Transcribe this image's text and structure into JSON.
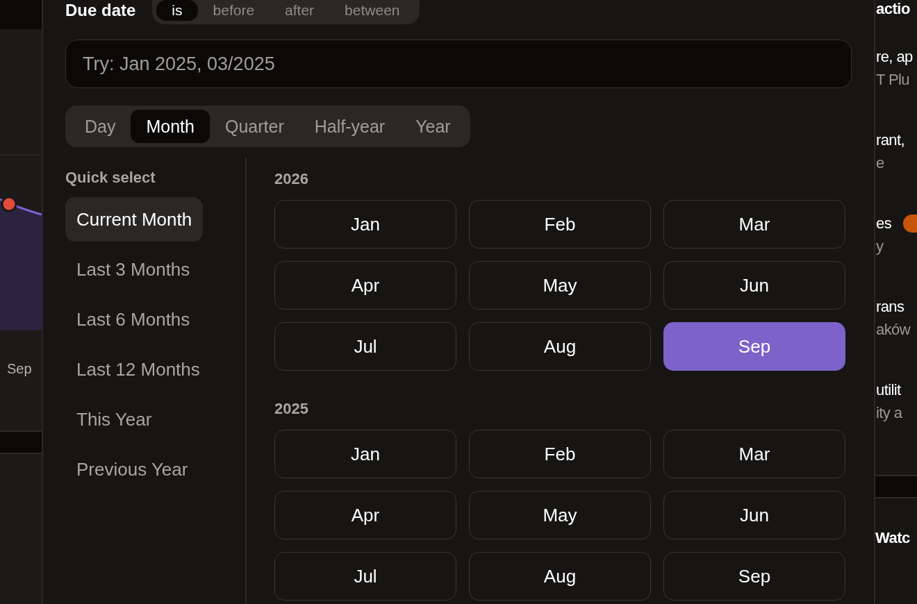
{
  "filter": {
    "label": "Due date",
    "operators": [
      {
        "label": "is",
        "selected": true
      },
      {
        "label": "before",
        "selected": false
      },
      {
        "label": "after",
        "selected": false
      },
      {
        "label": "between",
        "selected": false
      }
    ]
  },
  "search": {
    "placeholder": "Try: Jan 2025, 03/2025"
  },
  "granularity": [
    {
      "label": "Day",
      "selected": false
    },
    {
      "label": "Month",
      "selected": true
    },
    {
      "label": "Quarter",
      "selected": false
    },
    {
      "label": "Half-year",
      "selected": false
    },
    {
      "label": "Year",
      "selected": false
    }
  ],
  "quick_select": {
    "title": "Quick select",
    "items": [
      {
        "label": "Current Month",
        "selected": true
      },
      {
        "label": "Last 3 Months",
        "selected": false
      },
      {
        "label": "Last 6 Months",
        "selected": false
      },
      {
        "label": "Last 12 Months",
        "selected": false
      },
      {
        "label": "This Year",
        "selected": false
      },
      {
        "label": "Previous Year",
        "selected": false
      }
    ]
  },
  "years": [
    {
      "year": "2026",
      "months": [
        {
          "label": "Jan",
          "selected": false
        },
        {
          "label": "Feb",
          "selected": false
        },
        {
          "label": "Mar",
          "selected": false
        },
        {
          "label": "Apr",
          "selected": false
        },
        {
          "label": "May",
          "selected": false
        },
        {
          "label": "Jun",
          "selected": false
        },
        {
          "label": "Jul",
          "selected": false
        },
        {
          "label": "Aug",
          "selected": false
        },
        {
          "label": "Sep",
          "selected": true
        }
      ]
    },
    {
      "year": "2025",
      "months": [
        {
          "label": "Jan",
          "selected": false
        },
        {
          "label": "Feb",
          "selected": false
        },
        {
          "label": "Mar",
          "selected": false
        },
        {
          "label": "Apr",
          "selected": false
        },
        {
          "label": "May",
          "selected": false
        },
        {
          "label": "Jun",
          "selected": false
        },
        {
          "label": "Jul",
          "selected": false
        },
        {
          "label": "Aug",
          "selected": false
        },
        {
          "label": "Sep",
          "selected": false
        }
      ]
    }
  ],
  "background_left": {
    "axis_label": "Sep"
  },
  "background_right": {
    "heading": "actio",
    "items": [
      {
        "title": "re, ap",
        "subtitle": "T Plu",
        "badge": false
      },
      {
        "title": "rant,",
        "subtitle": "e",
        "badge": false
      },
      {
        "title": "es",
        "subtitle": "y",
        "badge": true
      },
      {
        "title": "rans",
        "subtitle": "aków",
        "badge": false
      },
      {
        "title": "utilit",
        "subtitle": "ity a",
        "badge": false
      }
    ],
    "footer_heading": "Watc"
  }
}
